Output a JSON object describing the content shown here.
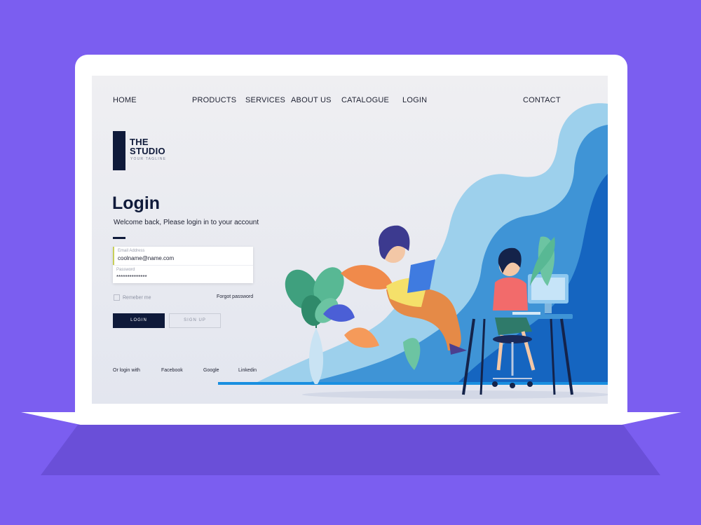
{
  "nav": {
    "home": "HOME",
    "products": "PRODUCTS",
    "services": "SERVICES",
    "about": "ABOUT US",
    "catalogue": "CATALOGUE",
    "login": "LOGIN",
    "contact": "CONTACT"
  },
  "logo": {
    "line1": "THE",
    "line2": "STUDIO",
    "tagline": "YOUR TAGLINE"
  },
  "login": {
    "title": "Login",
    "subtitle": "Welcome back, Please login in  to  your account",
    "email_label": "Email Address",
    "email_value": "coolname@name.com",
    "password_label": "Password",
    "password_value": "**************",
    "remember_label": "Remeber me",
    "forgot_label": "Forgot password",
    "login_button": "LOGIN",
    "signup_button": "SIGN UP"
  },
  "social": {
    "prompt": "Or  login with",
    "facebook": "Facebook",
    "google": "Google",
    "linkedin": "Linkedin"
  },
  "colors": {
    "background": "#7b5ef0",
    "navy": "#0f1a3a",
    "accent_blue": "#1a8fe0"
  }
}
